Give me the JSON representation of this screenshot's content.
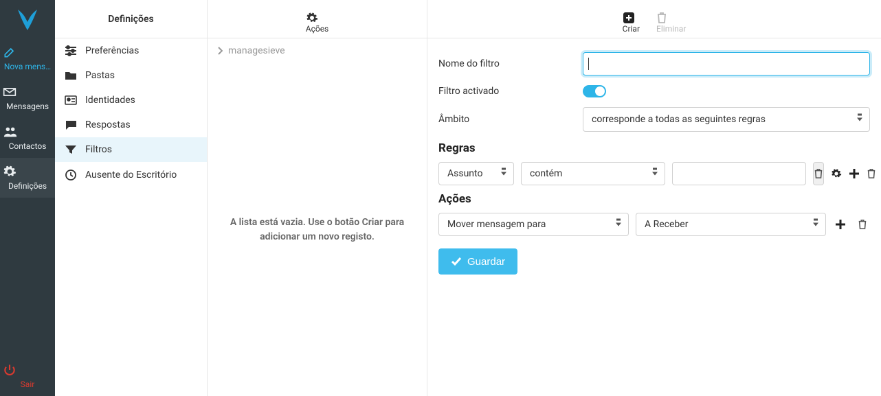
{
  "sidebar": {
    "new_message": "Nova mens…",
    "messages": "Mensagens",
    "contacts": "Contactos",
    "settings": "Definições",
    "logout": "Sair"
  },
  "settings_col": {
    "header": "Definições",
    "items": [
      {
        "label": "Preferências"
      },
      {
        "label": "Pastas"
      },
      {
        "label": "Identidades"
      },
      {
        "label": "Respostas"
      },
      {
        "label": "Filtros",
        "current": true
      },
      {
        "label": "Ausente do Escritório"
      }
    ]
  },
  "actions_col": {
    "toolbar_label": "Ações",
    "breadcrumb": "managesieve",
    "empty_message": "A lista está vazia. Use o botão Criar para adicionar um novo registo."
  },
  "main_col": {
    "toolbar": {
      "create": "Criar",
      "delete": "Eliminar"
    }
  },
  "form": {
    "name_label": "Nome do filtro",
    "name_value": "",
    "enabled_label": "Filtro activado",
    "enabled": true,
    "scope_label": "Âmbito",
    "scope_selected": "corresponde a todas as seguintes regras",
    "rules_heading": "Regras",
    "rules": [
      {
        "field": "Assunto",
        "operator": "contém",
        "value": ""
      }
    ],
    "actions_heading": "Ações",
    "actions": [
      {
        "action": "Mover mensagem para",
        "target": "A Receber"
      }
    ],
    "save_label": "Guardar"
  }
}
